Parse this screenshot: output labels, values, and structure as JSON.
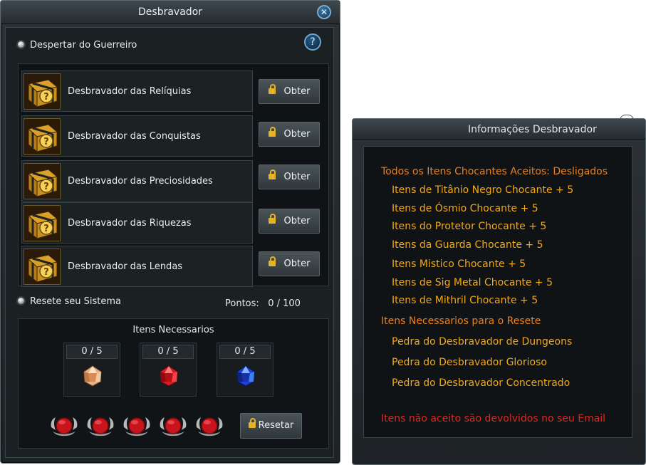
{
  "main_window": {
    "title": "Desbravador",
    "close_glyph": "✕",
    "help_glyph": "?",
    "section1_title": "Despertar do Guerreiro",
    "items": [
      {
        "label": "Desbravador das Relíquias",
        "button": "Obter"
      },
      {
        "label": "Desbravador das Conquistas",
        "button": "Obter"
      },
      {
        "label": "Desbravador das Preciosidades",
        "button": "Obter"
      },
      {
        "label": "Desbravador das Riquezas",
        "button": "Obter"
      },
      {
        "label": "Desbravador das Lendas",
        "button": "Obter"
      }
    ],
    "section2_title": "Resete seu Sistema",
    "points_label": "Pontos:",
    "points_value": "0 / 100",
    "required_title": "Itens Necessarios",
    "required_slots": [
      {
        "count": "0 / 5",
        "gem": "orange-stone-icon"
      },
      {
        "count": "0 / 5",
        "gem": "red-stone-icon"
      },
      {
        "count": "0 / 5",
        "gem": "blue-stone-icon"
      }
    ],
    "reset_button": "Resetar"
  },
  "info_window": {
    "title": "Informações Desbravador",
    "heading_accepted": "Todos os Itens Chocantes Aceitos: Desligados",
    "accepted_items": [
      "Itens de Titânio Negro Chocante + 5",
      "Itens de Ósmio Chocante + 5",
      "Itens do Protetor Chocante + 5",
      "Itens da Guarda Chocante + 5",
      "Itens Mistico Chocante + 5",
      "Itens de Sig Metal Chocante + 5",
      "Itens de Mithril Chocante + 5"
    ],
    "heading_required": "Itens Necessarios para o Resete",
    "required_items": [
      "Pedra do Desbravador de Dungeons",
      "Pedra do Desbravador Glorioso",
      "Pedra do Desbravador Concentrado"
    ],
    "warning": "Itens não aceito são devolvidos no seu Email"
  },
  "colors": {
    "heading_orange": "#e8811f",
    "item_yellow": "#f0a81c",
    "warning_red": "#e1261e"
  }
}
